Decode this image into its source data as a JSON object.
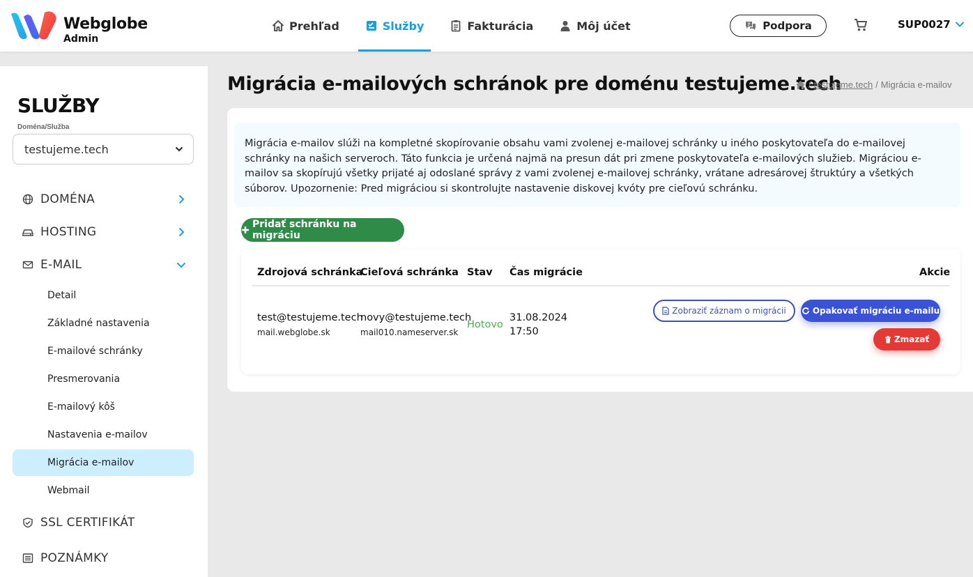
{
  "brand": {
    "name": "Webglobe",
    "subtitle": "Admin"
  },
  "nav": {
    "items": [
      {
        "label": "Prehľad",
        "icon": "home-icon",
        "active": false
      },
      {
        "label": "Služby",
        "icon": "services-icon",
        "active": true
      },
      {
        "label": "Fakturácia",
        "icon": "invoice-icon",
        "active": false
      },
      {
        "label": "Môj účet",
        "icon": "user-icon",
        "active": false
      }
    ],
    "support_label": "Podpora",
    "user_label": "SUP0027",
    "accent": "#1aa0d8"
  },
  "sidebar": {
    "title": "SLUŽBY",
    "domain_label": "Doména/Služba",
    "domain_value": "testujeme.tech",
    "sections": [
      {
        "label": "DOMÉNA",
        "icon": "globe-icon"
      },
      {
        "label": "HOSTING",
        "icon": "server-icon"
      },
      {
        "label": "E-MAIL",
        "icon": "envelope-icon"
      },
      {
        "label": "SSL CERTIFIKÁT",
        "icon": "shield-icon"
      },
      {
        "label": "POZNÁMKY",
        "icon": "notes-icon"
      }
    ],
    "email_items": [
      "Detail",
      "Základné nastavenia",
      "E-mailové schránky",
      "Presmerovania",
      "E-mailový kôš",
      "Nastavenia e-mailov",
      "Migrácia e-mailov",
      "Webmail"
    ],
    "active_item": "Migrácia e-mailov",
    "active_color": "#cdeefc"
  },
  "main": {
    "title": "Migrácia e-mailových schránok pre doménu testujeme.tech",
    "breadcrumb": {
      "link": "testujeme.tech",
      "separator": "/",
      "current": "Migrácia e-mailov"
    },
    "info_text": "Migrácia e-mailov slúži na kompletné skopírovanie obsahu vami zvolenej e-mailovej schránky u iného poskytovateľa do e-mailovej schránky na našich serveroch. Táto funkcia je určená najmä na presun dát pri zmene poskytovateľa e-mailových služieb. Migráciou e-mailov sa skopírujú všetky prijaté aj odoslané správy z vami zvolenej e-mailovej schránky, vrátane adresárovej štruktúry a všetkých súborov. Upozornenie: Pred migráciou si skontrolujte nastavenie diskovej kvóty pre cieľovú schránku.",
    "add_button": "Pridať schránku na migráciu",
    "table": {
      "headers": {
        "source": "Zdrojová schránka",
        "target": "Cieľová schránka",
        "status": "Stav",
        "time": "Čas migrácie",
        "actions": "Akcie"
      },
      "rows": [
        {
          "source_email": "test@testujeme.tech",
          "source_server": "mail.webglobe.sk",
          "target_email": "novy@testujeme.tech",
          "target_server": "mail010.nameserver.sk",
          "status": "Hotovo",
          "date": "31.08.2024",
          "time": "17:50",
          "actions": {
            "view": "Zobraziť záznam o migrácii",
            "retry": "Opakovať migráciu e-mailu",
            "delete": "Zmazať"
          }
        }
      ]
    }
  }
}
